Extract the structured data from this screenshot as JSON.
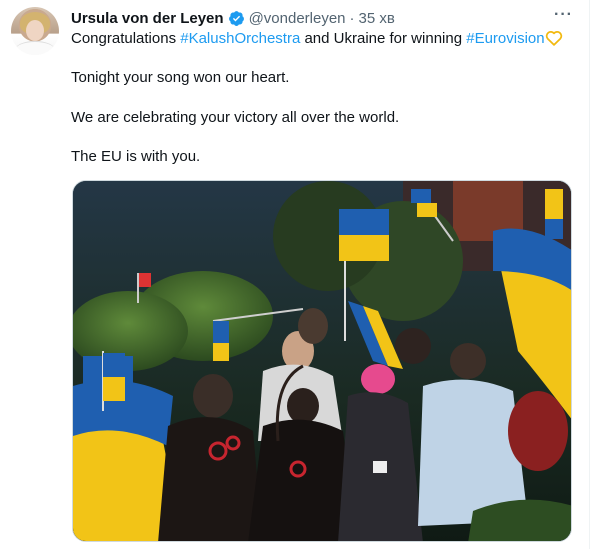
{
  "tweet": {
    "author_name": "Ursula von der Leyen",
    "handle": "@vonderleyen",
    "separator": "·",
    "timestamp": "35 хв",
    "more_icon": "more-horizontal-icon",
    "verified_icon": "verified-badge-icon",
    "line1": {
      "prefix": "Congratulations ",
      "hashtag1": "#KalushOrchestra",
      "middle": " and Ukraine for winning ",
      "hashtag2": "#Eurovision"
    },
    "line2": "Tonight your song won our heart.",
    "line3": "We are celebrating your victory all over the world.",
    "line4": "The EU is with you."
  },
  "colors": {
    "link": "#1d9bf0",
    "secondary_text": "#536471",
    "ukraine_blue": "#1f5fb0",
    "ukraine_yellow": "#f2c417"
  }
}
